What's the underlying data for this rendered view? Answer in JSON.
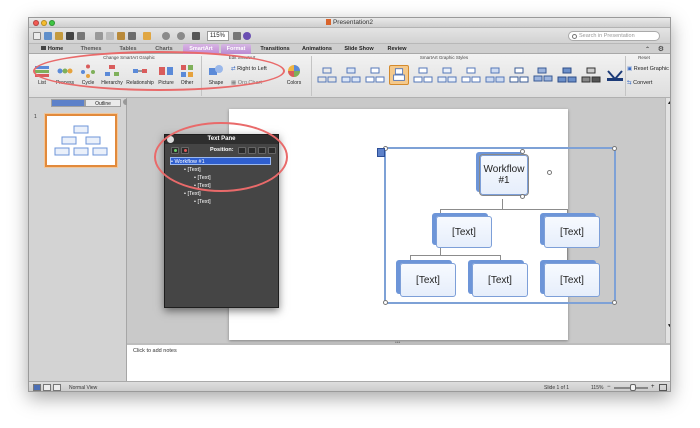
{
  "window": {
    "title": "Presentation2"
  },
  "quickbar": {
    "zoom": "115%",
    "search_placeholder": "Search in Presentation"
  },
  "tabs": [
    {
      "label": "Home"
    },
    {
      "label": "Themes"
    },
    {
      "label": "Tables"
    },
    {
      "label": "Charts"
    },
    {
      "label": "SmartArt"
    },
    {
      "label": "Format"
    },
    {
      "label": "Transitions"
    },
    {
      "label": "Animations"
    },
    {
      "label": "Slide Show"
    },
    {
      "label": "Review"
    }
  ],
  "ribbon": {
    "groups": {
      "change_graphic": "Change SmartArt Graphic",
      "edit": "Edit SmartArt",
      "styles": "SmartArt Graphic Styles",
      "reset": "Reset"
    },
    "layout_buttons": [
      "List",
      "Process",
      "Cycle",
      "Hierarchy",
      "Relationship",
      "Picture",
      "Other"
    ],
    "edit_buttons": {
      "shape": "Shape",
      "rtl": "Right to Left",
      "org_chart": "Org Chart",
      "colors": "Colors"
    },
    "reset_buttons": {
      "reset_graphic": "Reset Graphic",
      "convert": "Convert"
    }
  },
  "left_pane": {
    "tab_slides": "",
    "tab_outline": "Outline",
    "slide_number": "1"
  },
  "text_pane": {
    "title": "Text Pane",
    "position_label": "Position:",
    "items": [
      "Workflow #1",
      "[Text]",
      "[Text]",
      "[Text]",
      "[Text]",
      "[Text]"
    ]
  },
  "smartart": {
    "root": "Workflow #1",
    "level2": [
      "[Text]",
      "[Text]"
    ],
    "level3": [
      "[Text]",
      "[Text]",
      "[Text]"
    ]
  },
  "notes": {
    "placeholder": "Click to add notes"
  },
  "status": {
    "view": "Normal View",
    "slide": "Slide 1 of 1",
    "zoom": "115%"
  },
  "colors": {
    "accent_purple": "#c28ad6",
    "highlight_red": "#e96a6a",
    "smartart_blue": "#6d95d8",
    "selection_orange": "#e28a3b"
  }
}
